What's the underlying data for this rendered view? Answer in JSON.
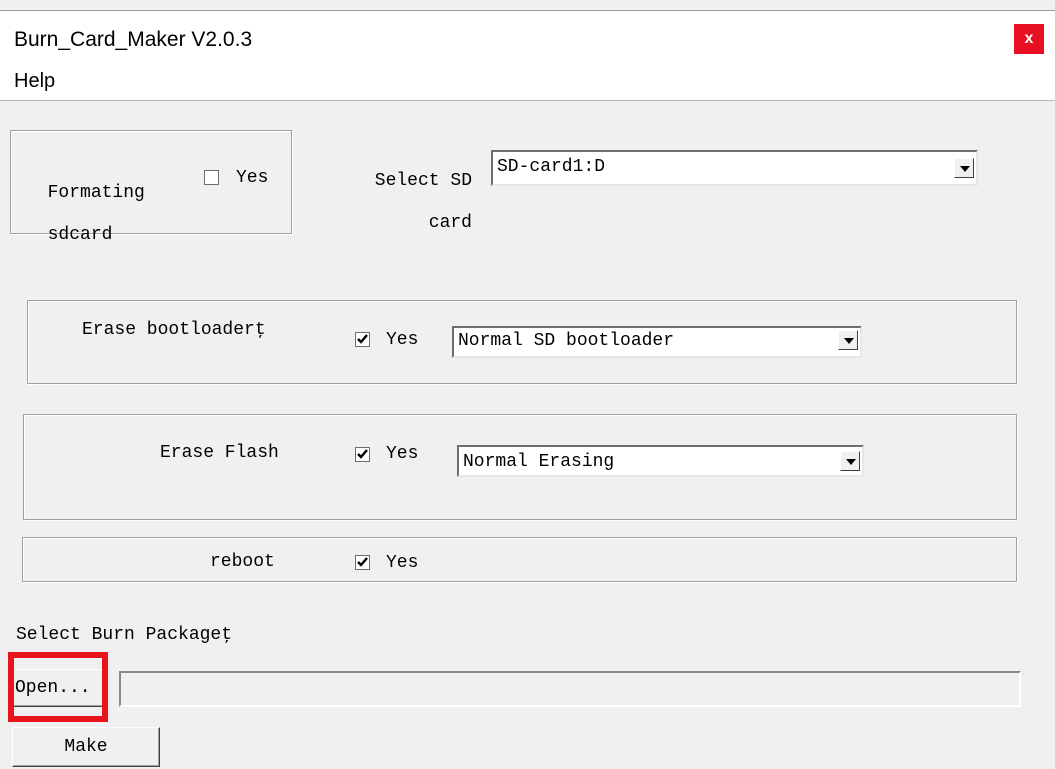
{
  "window": {
    "title": "Burn_Card_Maker V2.0.3",
    "close_label": "x"
  },
  "menu": {
    "help": "Help"
  },
  "format_group": {
    "label_line1": "Formating",
    "label_line2": "sdcard",
    "yes_label": "Yes",
    "checked": false
  },
  "sd_select": {
    "label_line1": "Select SD",
    "label_line2": "card",
    "value": "SD-card1:D"
  },
  "erase_bootloader": {
    "label": "Erase bootloaderţ",
    "yes_label": "Yes",
    "checked": true,
    "option": "Normal SD bootloader"
  },
  "erase_flash": {
    "label": "Erase Flash",
    "yes_label": "Yes",
    "checked": true,
    "option": "Normal Erasing"
  },
  "reboot": {
    "label": "reboot",
    "yes_label": "Yes",
    "checked": true
  },
  "package": {
    "label": "Select Burn Packageţ",
    "open_label": "Open...",
    "path_value": ""
  },
  "make_label": "Make",
  "colors": {
    "highlight": "#e8141c",
    "close_bg": "#e81123",
    "window_bg": "#f0f0f0"
  }
}
